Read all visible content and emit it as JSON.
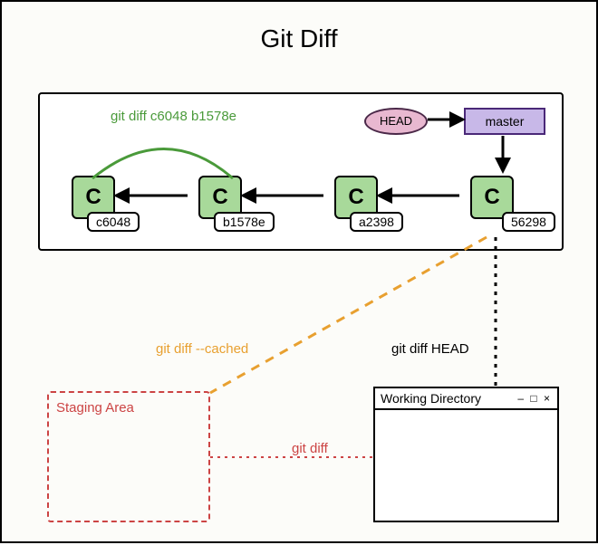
{
  "title": "Git Diff",
  "commits": [
    {
      "letter": "C",
      "hash": "c6048"
    },
    {
      "letter": "C",
      "hash": "b1578e"
    },
    {
      "letter": "C",
      "hash": "a2398"
    },
    {
      "letter": "C",
      "hash": "56298"
    }
  ],
  "head": "HEAD",
  "branch": "master",
  "staging_label": "Staging Area",
  "workdir_label": "Working Directory",
  "win_controls": "– □ ×",
  "labels": {
    "arc": "git diff c6048  b1578e",
    "cached": "git diff --cached",
    "head_diff": "git diff HEAD",
    "plain": "git diff"
  }
}
